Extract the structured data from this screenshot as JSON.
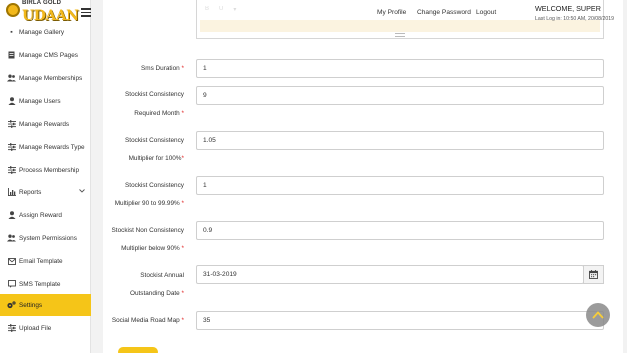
{
  "brand": {
    "line1": "BIRLA GOLD",
    "line2": "UDAAN"
  },
  "header": {
    "nav": [
      "My Profile",
      "Change Password",
      "Logout"
    ],
    "welcome": "WELCOME, SUPER",
    "last_login": "Last Log in: 10:50 AM, 20/08/2019"
  },
  "sidebar": {
    "items": [
      {
        "label": "Manage Gallery",
        "icon": "gallery-icon"
      },
      {
        "label": "Manage CMS Pages",
        "icon": "file-icon"
      },
      {
        "label": "Manage Memberships",
        "icon": "users-icon"
      },
      {
        "label": "Manage Users",
        "icon": "user-icon"
      },
      {
        "label": "Manage Rewards",
        "icon": "sliders-icon"
      },
      {
        "label": "Manage Rewards Type",
        "icon": "sliders-icon"
      },
      {
        "label": "Process Membership",
        "icon": "sliders-icon"
      },
      {
        "label": "Reports",
        "icon": "bar-chart-icon",
        "chevron": "chevron-down-icon"
      },
      {
        "label": "Assign Reward",
        "icon": "user-icon"
      },
      {
        "label": "System Permissions",
        "icon": "users-icon"
      },
      {
        "label": "Email Template",
        "icon": "envelope-icon"
      },
      {
        "label": "SMS Template",
        "icon": "message-icon"
      },
      {
        "label": "Settings",
        "icon": "gears-icon",
        "active": true
      },
      {
        "label": "Upload File",
        "icon": "sliders-icon"
      }
    ]
  },
  "form": {
    "fields": [
      {
        "label_lines": [
          "Sms Duration"
        ],
        "value": "1"
      },
      {
        "label_lines": [
          "Stockist Consistency",
          "Required Month"
        ],
        "value": "9"
      },
      {
        "label_lines": [
          "Stockist Consistency",
          "Multiplier for 100%"
        ],
        "value": "1.05"
      },
      {
        "label_lines": [
          "Stockist Consistency",
          "Multiplier 90 to 99.99%"
        ],
        "value": "1"
      },
      {
        "label_lines": [
          "Stockist Non Consistency",
          "Multiplier below 90%"
        ],
        "value": "0.9"
      },
      {
        "label_lines": [
          "Stockist Annual",
          "Outstanding Date"
        ],
        "value": "31-03-2019"
      },
      {
        "label_lines": [
          "Social Media Road Map"
        ],
        "value": "35"
      }
    ],
    "required_mark": "*"
  },
  "colors": {
    "accent": "#f5c518",
    "required": "#e02020"
  }
}
